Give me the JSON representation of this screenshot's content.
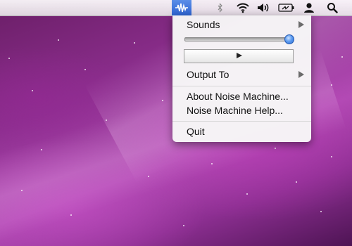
{
  "menubar": {
    "status_icons": [
      "noise-machine-icon",
      "bluetooth-icon",
      "wifi-icon",
      "volume-icon",
      "battery-icon",
      "user-icon",
      "spotlight-icon"
    ],
    "active_color": "#2d63d1"
  },
  "menu": {
    "sounds_label": "Sounds",
    "volume_level": 1.0,
    "output_label": "Output To",
    "about_label": "About Noise Machine...",
    "help_label": "Noise Machine Help...",
    "quit_label": "Quit"
  }
}
